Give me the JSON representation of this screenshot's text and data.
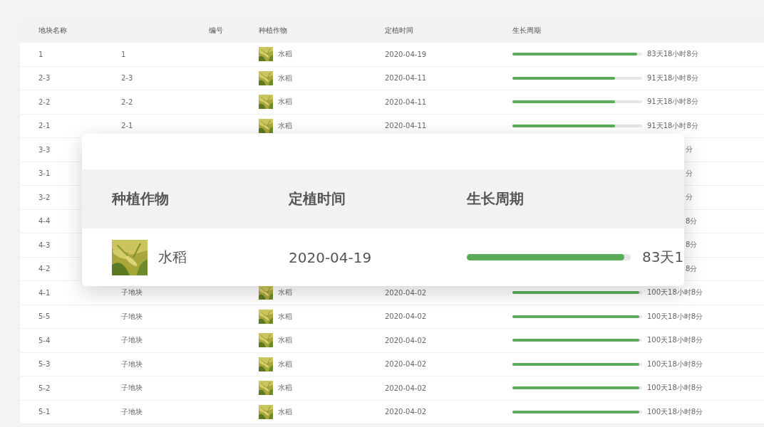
{
  "table": {
    "columns": [
      "地块名称",
      "编号",
      "种植作物",
      "定植时间",
      "生长周期"
    ],
    "rows": [
      {
        "name": "1",
        "code": "1",
        "crop": "水稻",
        "date": "2020-04-19",
        "level": 0.96,
        "duration": "83天18小时8分"
      },
      {
        "name": "2-3",
        "code": "2-3",
        "crop": "水稻",
        "date": "2020-04-11",
        "level": 0.79,
        "duration": "91天18小时8分"
      },
      {
        "name": "2-2",
        "code": "2-2",
        "crop": "水稻",
        "date": "2020-04-11",
        "level": 0.79,
        "duration": "91天18小时8分"
      },
      {
        "name": "2-1",
        "code": "2-1",
        "crop": "水稻",
        "date": "2020-04-11",
        "level": 0.79,
        "duration": "91天18小时8分"
      },
      {
        "name": "3-3",
        "duration": "分"
      },
      {
        "name": "3-1",
        "duration": "分"
      },
      {
        "name": "3-2",
        "duration": "分"
      },
      {
        "name": "4-4",
        "duration": "8分"
      },
      {
        "name": "4-3",
        "duration": "8分"
      },
      {
        "name": "4-2",
        "duration": "8分"
      },
      {
        "name": "4-1",
        "code": "子地块",
        "crop": "水稻",
        "date": "2020-04-02",
        "level": 0.98,
        "duration": "100天18小时8分"
      },
      {
        "name": "5-5",
        "code": "子地块",
        "crop": "水稻",
        "date": "2020-04-02",
        "level": 0.98,
        "duration": "100天18小时8分"
      },
      {
        "name": "5-4",
        "code": "子地块",
        "crop": "水稻",
        "date": "2020-04-02",
        "level": 0.98,
        "duration": "100天18小时8分"
      },
      {
        "name": "5-3",
        "code": "子地块",
        "crop": "水稻",
        "date": "2020-04-02",
        "level": 0.98,
        "duration": "100天18小时8分"
      },
      {
        "name": "5-2",
        "code": "子地块",
        "crop": "水稻",
        "date": "2020-04-02",
        "level": 0.98,
        "duration": "100天18小时8分"
      },
      {
        "name": "5-1",
        "code": "子地块",
        "crop": "水稻",
        "date": "2020-04-02",
        "level": 0.98,
        "duration": "100天18小时8分"
      }
    ]
  },
  "zoom_card": {
    "columns": [
      "种植作物",
      "定植时间",
      "生长周期"
    ],
    "row": {
      "crop": "水稻",
      "date": "2020-04-19",
      "level": 0.96,
      "duration": "83天1"
    }
  }
}
